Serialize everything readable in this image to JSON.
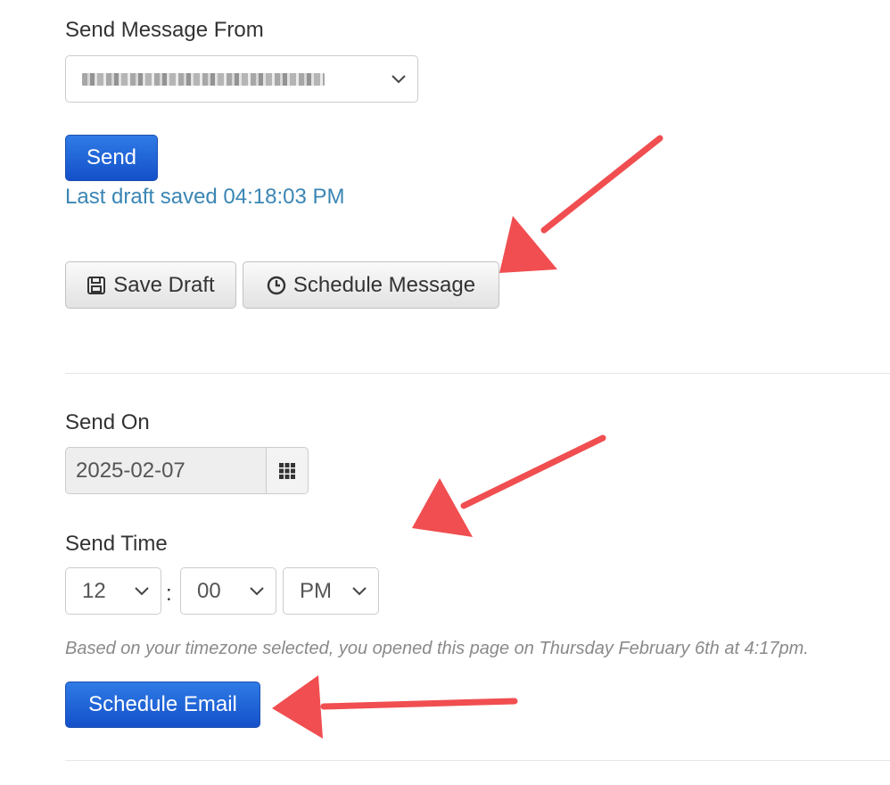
{
  "sender": {
    "label": "Send Message From",
    "selected_value": "name@example.com"
  },
  "send_button": "Send",
  "draft_status": "Last draft saved 04:18:03 PM",
  "actions": {
    "save_draft": "Save Draft",
    "schedule_message": "Schedule Message"
  },
  "schedule": {
    "send_on_label": "Send On",
    "date_value": "2025-02-07",
    "send_time_label": "Send Time",
    "hour": "12",
    "separator": ":",
    "minute": "00",
    "meridiem": "PM",
    "timezone_note": "Based on your timezone selected, you opened this page on Thursday February 6th at 4:17pm.",
    "schedule_button": "Schedule Email"
  },
  "annotation_color": "#f04e50"
}
